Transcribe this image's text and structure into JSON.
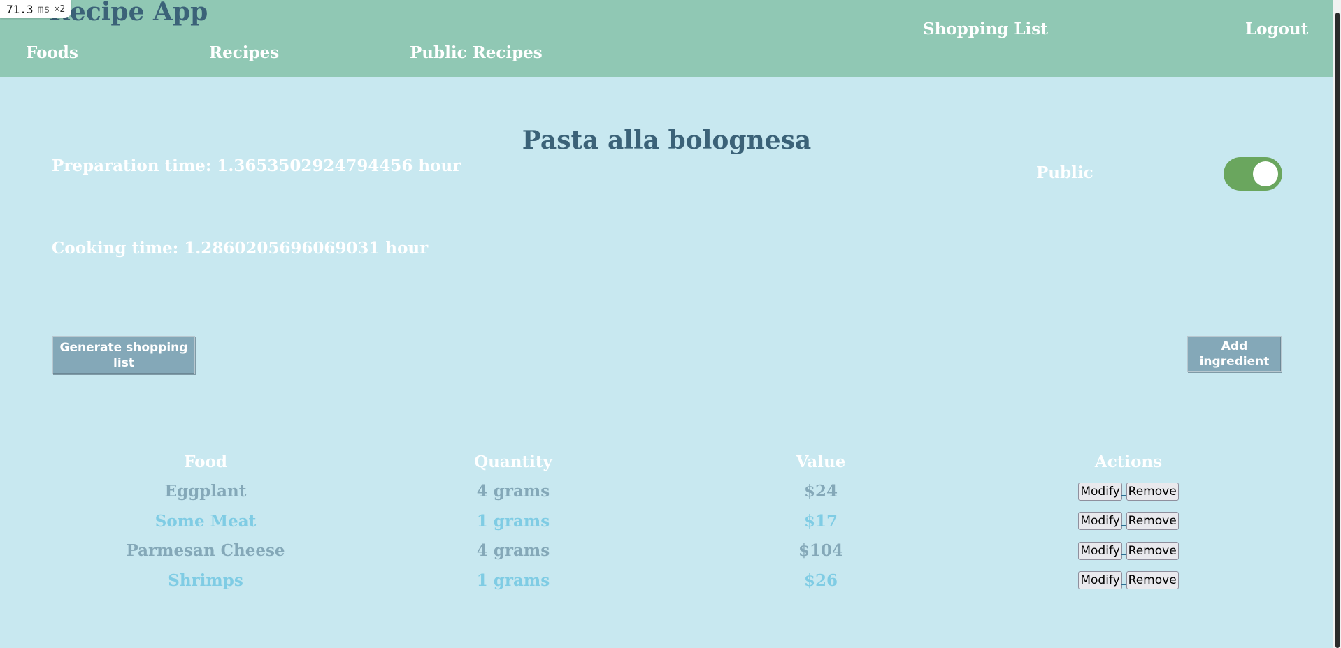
{
  "nav": {
    "brand": "Recipe App",
    "links": {
      "foods": "Foods",
      "recipes": "Recipes",
      "public_recipes": "Public Recipes",
      "shopping_list": "Shopping List",
      "logout": "Logout"
    }
  },
  "perf_badge": {
    "value": "71.3",
    "unit": "ms",
    "multiplier": "×2"
  },
  "recipe": {
    "title": "Pasta alla bolognesa",
    "preparation_time": "Preparation time: 1.3653502924794456 hour",
    "cooking_time": "Cooking time: 1.2860205696069031 hour",
    "public_label": "Public",
    "public_enabled": true
  },
  "buttons": {
    "generate_shopping_list": "Generate shopping list",
    "add_ingredient": "Add ingredient"
  },
  "table": {
    "headers": [
      "Food",
      "Quantity",
      "Value",
      "Actions"
    ],
    "action_labels": {
      "modify": "Modify",
      "remove": "Remove"
    },
    "rows": [
      {
        "food": "Eggplant",
        "quantity": "4 grams",
        "value": "$24"
      },
      {
        "food": "Some Meat",
        "quantity": "1 grams",
        "value": "$17"
      },
      {
        "food": "Parmesan Cheese",
        "quantity": "4 grams",
        "value": "$104"
      },
      {
        "food": "Shrimps",
        "quantity": "1 grams",
        "value": "$26"
      }
    ]
  },
  "colors": {
    "navbar": "#90c8b4",
    "background": "#c8e8f0",
    "title": "#3b6278",
    "toggle_on": "#6aa65e",
    "button": "#84a8b8",
    "row_odd": "#84a8b8",
    "row_even": "#7fcce4"
  }
}
